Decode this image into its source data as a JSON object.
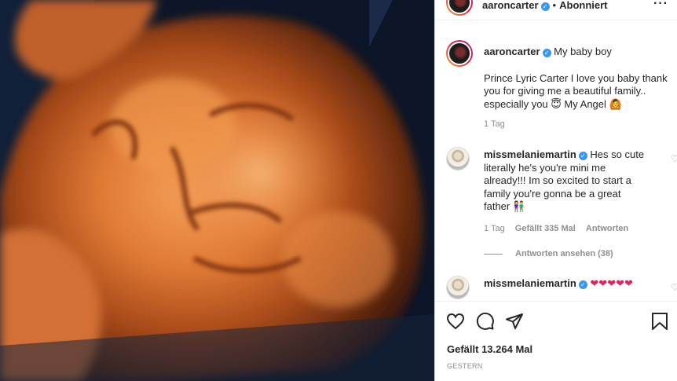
{
  "header": {
    "username": "aaroncarter",
    "separator": "•",
    "follow_status": "Abonniert",
    "more_icon": "more-horizontal-icon"
  },
  "caption": {
    "username": "aaroncarter",
    "title": "My baby boy",
    "text": "Prince Lyric Carter I love you baby thank you for giving me a beautiful family.. especially you 😇 My Angel 🙆",
    "time": "1 Tag"
  },
  "comments": [
    {
      "username": "missmelaniemartin",
      "text": "Hes so cute literally he's you're mini me already!!! Im so excited to start a family you're gonna be a great father 👫",
      "time": "1 Tag",
      "likes": "Gefällt 335 Mal",
      "reply_label": "Antworten",
      "view_replies": "Antworten ansehen (38)"
    },
    {
      "username": "missmelaniemartin",
      "text": "❤❤❤❤❤"
    }
  ],
  "actions": {
    "like_icon": "heart-icon",
    "comment_icon": "comment-icon",
    "share_icon": "share-icon",
    "save_icon": "bookmark-icon"
  },
  "likes_count": "Gefällt 13.264 Mal",
  "post_date": "GESTERN",
  "colors": {
    "verified": "#3897f0",
    "secondary_text": "#8e8e8e",
    "heart_red": "#e0245e"
  }
}
